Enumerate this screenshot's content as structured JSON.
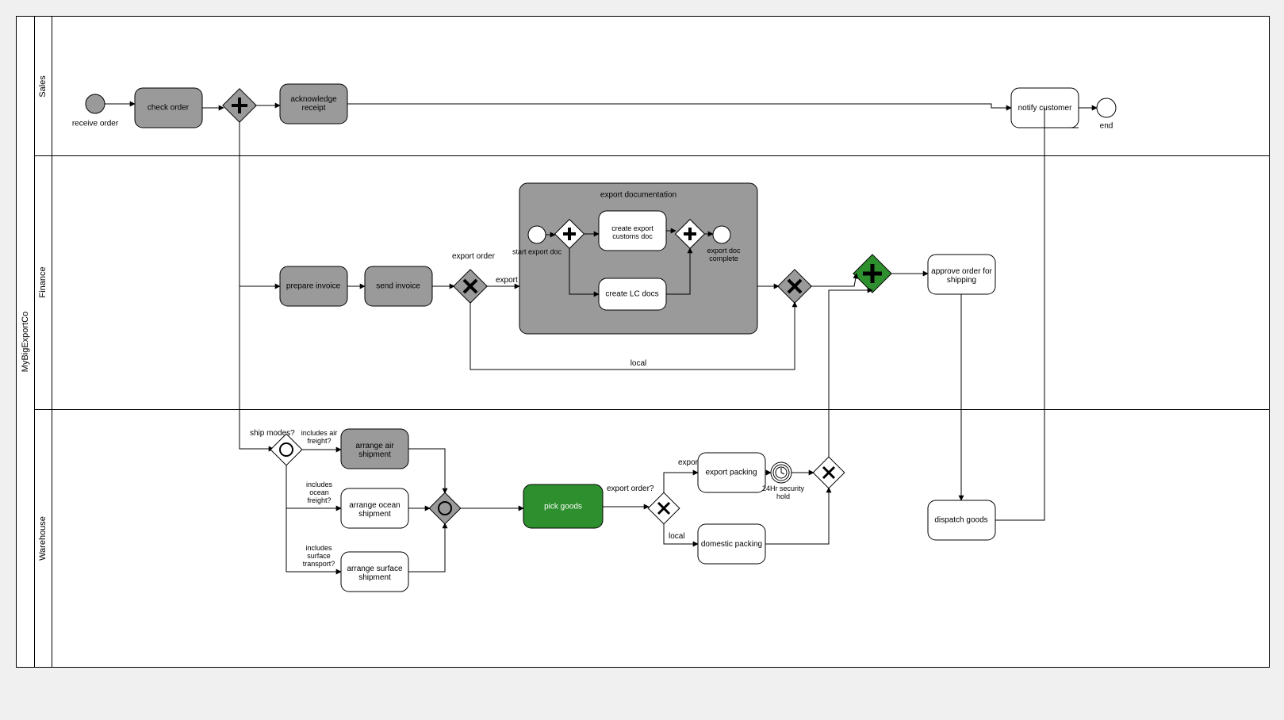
{
  "pool": "MyBigExportCo",
  "lanes": {
    "sales": "Sales",
    "finance": "Finance",
    "warehouse": "Warehouse"
  },
  "events": {
    "receiveOrder": "receive order",
    "end": "end",
    "startExportDoc": "start export doc",
    "exportDocComplete": "export doc complete",
    "securityHold": "24Hr security hold"
  },
  "tasks": {
    "checkOrder": "check order",
    "ackReceipt": "acknowledge receipt",
    "notifyCustomer": "notify customer",
    "prepareInvoice": "prepare invoice",
    "sendInvoice": "send invoice",
    "createExportCustoms": "create export customs doc",
    "createLC": "create LC docs",
    "approveOrder": "approve order for shipping",
    "arrangeAir": "arrange air shipment",
    "arrangeOcean": "arrange ocean shipment",
    "arrangeSurface": "arrange surface shipment",
    "pickGoods": "pick goods",
    "exportPacking": "export packing",
    "domesticPacking": "domestic packing",
    "dispatchGoods": "dispatch goods"
  },
  "subprocess": {
    "exportDocumentation": "export documentation"
  },
  "edgeLabels": {
    "exportOrder": "export order",
    "export": "export",
    "local": "local",
    "shipModes": "ship modes?",
    "includesAir": "includes air freight?",
    "includesOcean": "includes ocean freight?",
    "includesSurface": "includes surface transport?",
    "exportOrderQ": "export order?",
    "export2": "export",
    "local2": "local"
  }
}
